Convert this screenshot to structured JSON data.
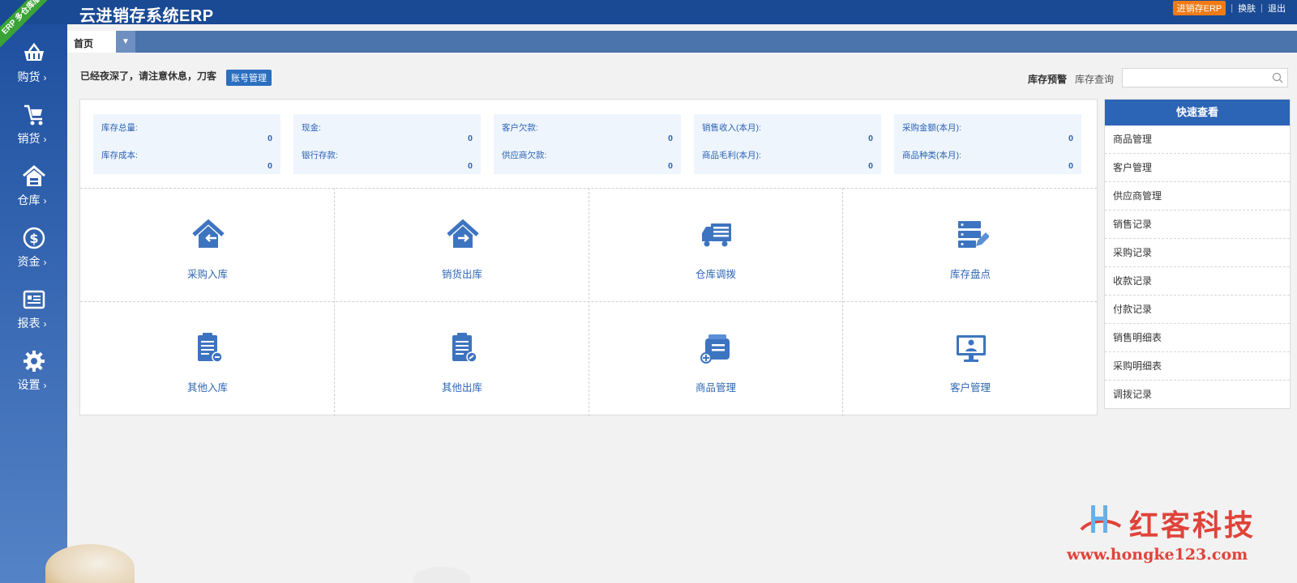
{
  "header": {
    "title": "云进销存系统ERP",
    "ribbon": "ERP 多仓库版",
    "badge": "进销存ERP",
    "links": [
      "换肤",
      "退出"
    ]
  },
  "tabs": [
    {
      "label": "首页"
    }
  ],
  "sidebar": {
    "items": [
      {
        "label": "购货",
        "icon": "basket-icon"
      },
      {
        "label": "销货",
        "icon": "cart-icon"
      },
      {
        "label": "仓库",
        "icon": "warehouse-icon"
      },
      {
        "label": "资金",
        "icon": "dollar-icon"
      },
      {
        "label": "报表",
        "icon": "report-icon"
      },
      {
        "label": "设置",
        "icon": "gear-icon"
      }
    ]
  },
  "greeting": {
    "text": "已经夜深了，请注意休息，刀客",
    "account_button": "账号管理",
    "stock_warning": "库存预警",
    "stock_query": "库存查询",
    "search_placeholder": ""
  },
  "stats": [
    {
      "label1": "库存总量:",
      "value1": "0",
      "label2": "库存成本:",
      "value2": "0"
    },
    {
      "label1": "现金:",
      "value1": "0",
      "label2": "银行存款:",
      "value2": "0"
    },
    {
      "label1": "客户欠款:",
      "value1": "0",
      "label2": "供应商欠款:",
      "value2": "0"
    },
    {
      "label1": "销售收入(本月):",
      "value1": "0",
      "label2": "商品毛利(本月):",
      "value2": "0"
    },
    {
      "label1": "采购金额(本月):",
      "value1": "0",
      "label2": "商品种类(本月):",
      "value2": "0"
    }
  ],
  "tiles": [
    {
      "label": "采购入库",
      "icon": "house-in-icon"
    },
    {
      "label": "销货出库",
      "icon": "house-out-icon"
    },
    {
      "label": "仓库调拨",
      "icon": "truck-icon"
    },
    {
      "label": "库存盘点",
      "icon": "server-edit-icon"
    },
    {
      "label": "其他入库",
      "icon": "clipboard-in-icon"
    },
    {
      "label": "其他出库",
      "icon": "clipboard-out-icon"
    },
    {
      "label": "商品管理",
      "icon": "box-add-icon"
    },
    {
      "label": "客户管理",
      "icon": "monitor-user-icon"
    }
  ],
  "quick": {
    "title": "快速查看",
    "items": [
      "商品管理",
      "客户管理",
      "供应商管理",
      "销售记录",
      "采购记录",
      "收款记录",
      "付款记录",
      "销售明细表",
      "采购明细表",
      "调拨记录"
    ]
  },
  "watermark": {
    "name": "红客科技",
    "url": "www.hongke123.com"
  },
  "colors": {
    "header": "#1a4a93",
    "tabbar": "#4b73ac",
    "accent": "#2c64b6",
    "badge": "#f07a16",
    "watermark": "#e0433a"
  }
}
